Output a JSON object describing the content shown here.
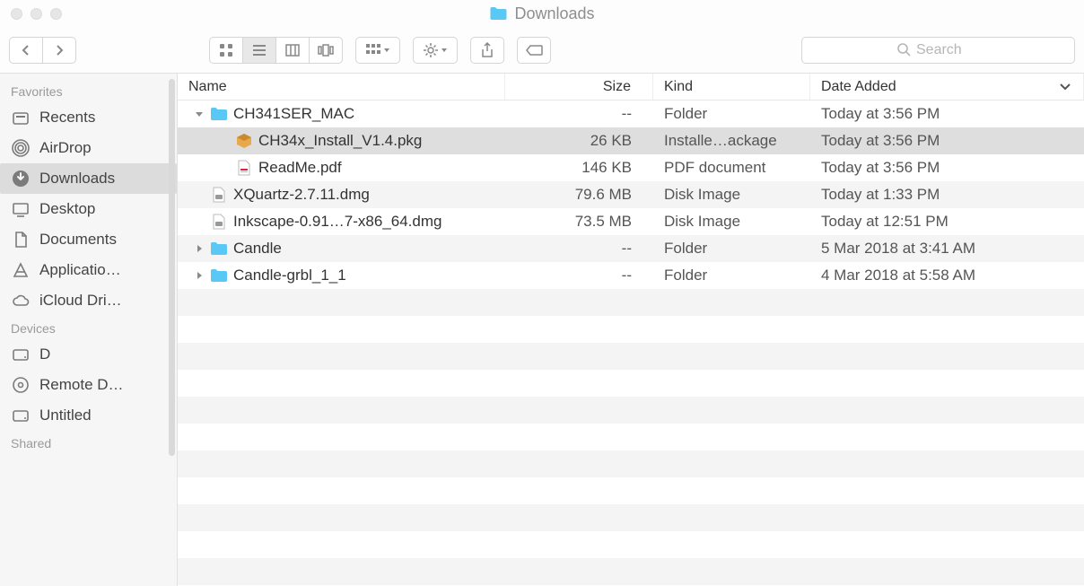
{
  "window": {
    "title": "Downloads",
    "accent_folder_color": "#5ac8f5"
  },
  "toolbar": {
    "search_placeholder": "Search"
  },
  "sidebar": {
    "sections": [
      {
        "label": "Favorites",
        "items": [
          {
            "icon": "recents",
            "label": "Recents"
          },
          {
            "icon": "airdrop",
            "label": "AirDrop"
          },
          {
            "icon": "downloads",
            "label": "Downloads",
            "active": true
          },
          {
            "icon": "desktop",
            "label": "Desktop"
          },
          {
            "icon": "documents",
            "label": "Documents"
          },
          {
            "icon": "applications",
            "label": "Applicatio…"
          },
          {
            "icon": "icloud",
            "label": "iCloud Dri…"
          }
        ]
      },
      {
        "label": "Devices",
        "items": [
          {
            "icon": "hdd",
            "label": "D"
          },
          {
            "icon": "remotedisc",
            "label": "Remote D…"
          },
          {
            "icon": "hdd",
            "label": "Untitled"
          }
        ]
      },
      {
        "label": "Shared",
        "items": []
      }
    ]
  },
  "columns": {
    "name": "Name",
    "size": "Size",
    "kind": "Kind",
    "date": "Date Added"
  },
  "rows": [
    {
      "indent": 0,
      "disclosure": "open",
      "icon": "folder",
      "name": "CH341SER_MAC",
      "size": "--",
      "kind": "Folder",
      "date": "Today at 3:56 PM",
      "selected": false
    },
    {
      "indent": 1,
      "disclosure": "none",
      "icon": "pkg",
      "name": "CH34x_Install_V1.4.pkg",
      "size": "26 KB",
      "kind": "Installe…ackage",
      "date": "Today at 3:56 PM",
      "selected": true
    },
    {
      "indent": 1,
      "disclosure": "none",
      "icon": "pdf",
      "name": "ReadMe.pdf",
      "size": "146 KB",
      "kind": "PDF document",
      "date": "Today at 3:56 PM",
      "selected": false
    },
    {
      "indent": 0,
      "disclosure": "none",
      "icon": "dmg",
      "name": "XQuartz-2.7.11.dmg",
      "size": "79.6 MB",
      "kind": "Disk Image",
      "date": "Today at 1:33 PM",
      "selected": false
    },
    {
      "indent": 0,
      "disclosure": "none",
      "icon": "dmg",
      "name": "Inkscape-0.91…7-x86_64.dmg",
      "size": "73.5 MB",
      "kind": "Disk Image",
      "date": "Today at 12:51 PM",
      "selected": false
    },
    {
      "indent": 0,
      "disclosure": "closed",
      "icon": "folder",
      "name": "Candle",
      "size": "--",
      "kind": "Folder",
      "date": "5 Mar 2018 at 3:41 AM",
      "selected": false
    },
    {
      "indent": 0,
      "disclosure": "closed",
      "icon": "folder",
      "name": "Candle-grbl_1_1",
      "size": "--",
      "kind": "Folder",
      "date": "4 Mar 2018 at 5:58 AM",
      "selected": false
    }
  ]
}
